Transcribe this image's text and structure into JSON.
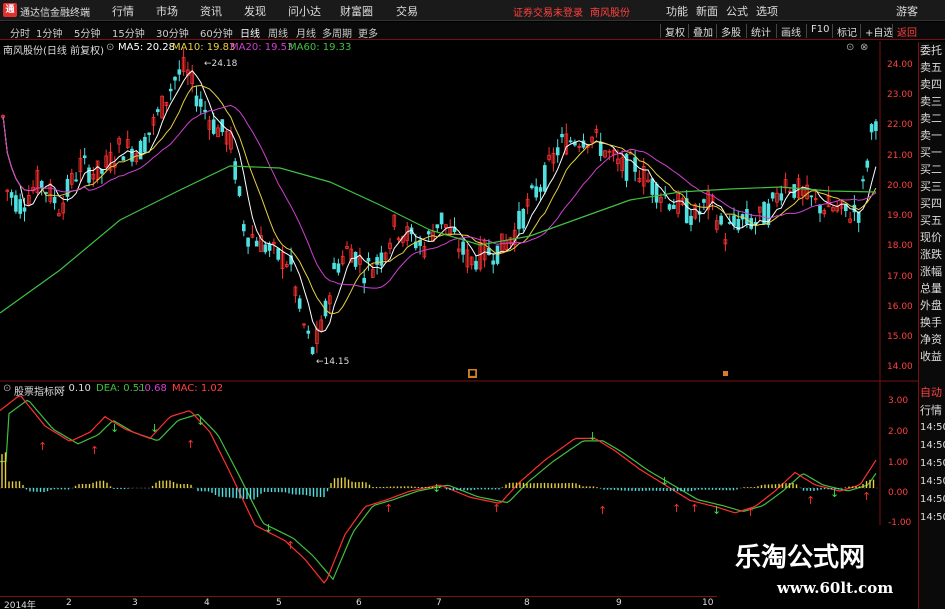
{
  "app": {
    "logo_text": "通",
    "title": "通达信金融终端"
  },
  "menu": {
    "items": [
      "行情",
      "市场",
      "资讯",
      "发现",
      "问小达",
      "财富圈",
      "交易"
    ],
    "notice": "证券交易未登录",
    "stock": "南风股份",
    "right": [
      "功能",
      "新面",
      "公式",
      "选项",
      "游客"
    ]
  },
  "periods": [
    "分时",
    "1分钟",
    "5分钟",
    "15分钟",
    "30分钟",
    "60分钟",
    "日线",
    "周线",
    "月线",
    "多周期",
    "更多"
  ],
  "toolbar": [
    "复权",
    "叠加",
    "多股",
    "统计",
    "画线",
    "F10",
    "标记",
    "+自选",
    "返回"
  ],
  "info": {
    "name": "南风股份(日线 前复权)",
    "ma5": "MA5: 20.28",
    "ma10": "MA10: 19.83",
    "ma20": "MA20: 19.53",
    "ma60": "MA60: 19.33"
  },
  "colors": {
    "up": "#ff3030",
    "down": "#50e0e0",
    "ma5": "#ffffff",
    "ma10": "#e8d040",
    "ma20": "#d040d0",
    "ma60": "#40c040",
    "grid": "#7a1010"
  },
  "price_axis": [
    "24.00",
    "23.00",
    "22.00",
    "21.00",
    "20.00",
    "19.00",
    "18.00",
    "17.00",
    "16.00",
    "15.00",
    "14.00"
  ],
  "annotations": {
    "high": "24.18",
    "low": "14.15"
  },
  "macd": {
    "name": "股票指标网",
    "v": ": 0.10",
    "dea": "DEA: 0.51",
    "val3": ": 0.68",
    "mac": "MAC: 1.02"
  },
  "macd_axis": [
    "3.00",
    "2.00",
    "1.00",
    "0.00",
    "-1.00"
  ],
  "side_top": [
    "委托",
    "卖五",
    "卖四",
    "卖三",
    "卖二",
    "卖一",
    "买一",
    "买二",
    "买三",
    "买四",
    "买五",
    "现价",
    "涨跌",
    "涨幅",
    "总量",
    "外盘",
    "换手",
    "净资",
    "收益"
  ],
  "side_bottom": [
    "自动",
    "行情",
    "14:50",
    "14:50",
    "14:50",
    "14:50",
    "14:50",
    "14:50"
  ],
  "time_axis": [
    "2014年",
    "2",
    "3",
    "4",
    "5",
    "6",
    "7",
    "8",
    "9",
    "10"
  ],
  "watermark": {
    "title": "乐淘公式网",
    "url": "www.60lt.com"
  }
}
